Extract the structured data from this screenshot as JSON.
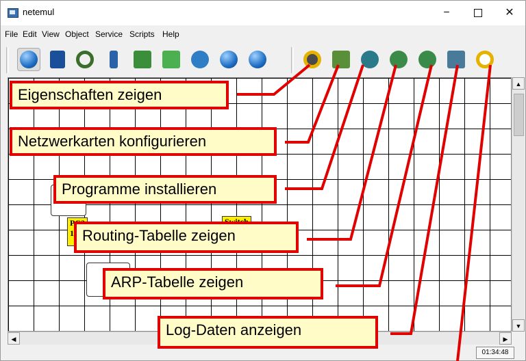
{
  "window": {
    "title": "netemul",
    "min_symbol": "−",
    "close_symbol": "✕"
  },
  "menu": [
    "File",
    "Edit",
    "View",
    "Object",
    "Service",
    "Scripts",
    "Help"
  ],
  "toolbar_icons": [
    "select-tool-icon",
    "note-tool-icon",
    "cable-tool-icon",
    "computer-tool-icon",
    "hub-tool-icon",
    "switch-tool-icon",
    "router-tool-icon",
    "arrow-tool-icon",
    "pause-icon",
    "properties-icon",
    "network-card-icon",
    "install-programs-icon",
    "routing-table-icon",
    "arp-table-icon",
    "log-data-icon",
    "settings-icon"
  ],
  "canvas": {
    "nodes": {
      "pc_label": "PC2",
      "pc_label_num": "1",
      "switch_label": "Switch"
    }
  },
  "callouts": {
    "properties": "Eigenschaften zeigen",
    "network_cards": "Netzwerkarten konfigurieren",
    "programs": "Programme installieren",
    "routing": "Routing-Tabelle zeigen",
    "arp": "ARP-Tabelle zeigen",
    "log": "Log-Daten anzeigen"
  },
  "status": {
    "clock": "01:34:48"
  },
  "colors": {
    "callout_border": "#e00000",
    "callout_fill": "#fffcc8",
    "node_label": "#ffee00"
  }
}
